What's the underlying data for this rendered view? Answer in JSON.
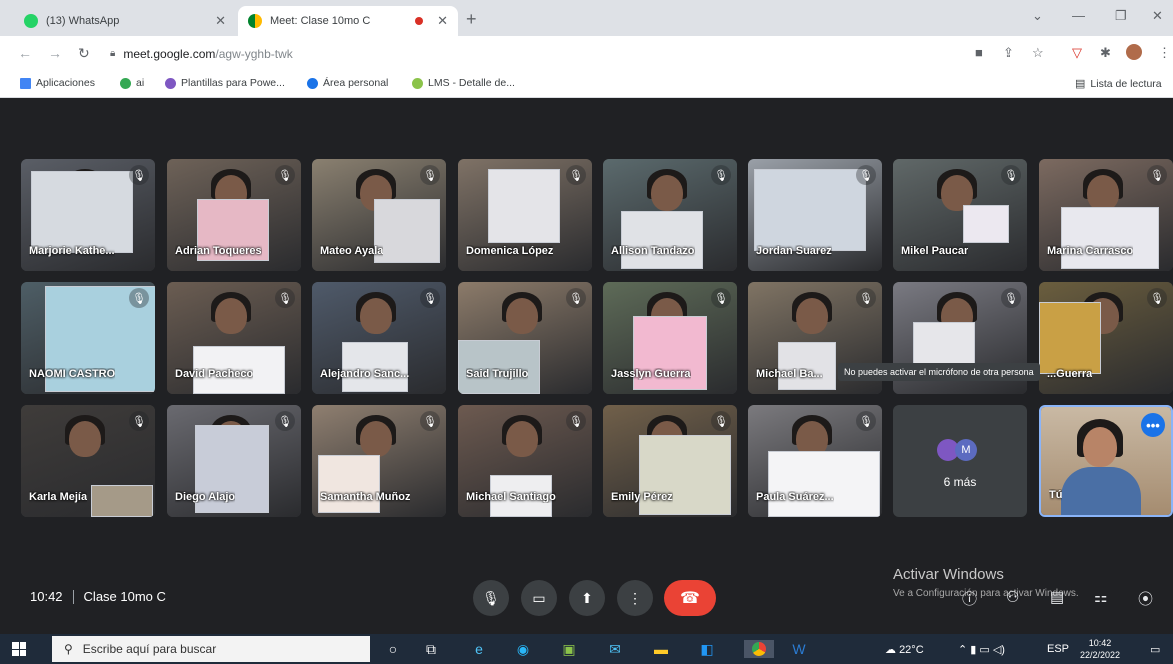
{
  "browser": {
    "tabs": [
      {
        "title": "(13) WhatsApp",
        "active": false
      },
      {
        "title": "Meet: Clase 10mo C",
        "active": true
      }
    ],
    "url_host": "meet.google.com",
    "url_path": "/agw-yghb-twk",
    "reading_list": "Lista de lectura"
  },
  "bookmarks": [
    {
      "label": "Aplicaciones",
      "color": "#4285f4"
    },
    {
      "label": "ai",
      "color": "#34a853"
    },
    {
      "label": "Plantillas para Powe...",
      "color": "#7e57c2"
    },
    {
      "label": "Área personal",
      "color": "#1a73e8"
    },
    {
      "label": "LMS - Detalle de...",
      "color": "#8bc34a"
    }
  ],
  "participants": [
    {
      "name": "Marjorie Kathe..."
    },
    {
      "name": "Adrian Toqueres"
    },
    {
      "name": "Mateo Ayala"
    },
    {
      "name": "Domenica López"
    },
    {
      "name": "Allison Tandazo"
    },
    {
      "name": "Jordan Suarez"
    },
    {
      "name": "Mikel Paucar"
    },
    {
      "name": "Marina Carrasco"
    },
    {
      "name": "NAOMI CASTRO"
    },
    {
      "name": "David Pacheco"
    },
    {
      "name": "Alejandro Sanc..."
    },
    {
      "name": "Said Trujillo"
    },
    {
      "name": "Jasslyn Guerra"
    },
    {
      "name": "Michael Ba..."
    },
    {
      "name": ""
    },
    {
      "name": "...Guerra"
    },
    {
      "name": "Karla Mejía"
    },
    {
      "name": "Diego Alajo"
    },
    {
      "name": "Samantha Muñoz"
    },
    {
      "name": "Michael Santiago"
    },
    {
      "name": "Emily Pérez"
    },
    {
      "name": "Paula Suárez..."
    }
  ],
  "more": {
    "label": "6 más",
    "avatar_letter": "M"
  },
  "self": {
    "name": "Tú"
  },
  "tooltip": "No puedes activar el micrófono de otra persona",
  "meeting": {
    "time": "10:42",
    "title": "Clase 10mo C"
  },
  "windows_watermark": {
    "line1": "Activar Windows",
    "line2": "Ve a Configuración para activar Windows."
  },
  "taskbar": {
    "search_placeholder": "Escribe aquí para buscar",
    "weather": "22°C",
    "language": "ESP",
    "time": "10:42",
    "date": "22/2/2022"
  },
  "colors": {
    "hangup": "#ea4335",
    "self_border": "#8ab4f8",
    "meet_bg": "#202124"
  }
}
